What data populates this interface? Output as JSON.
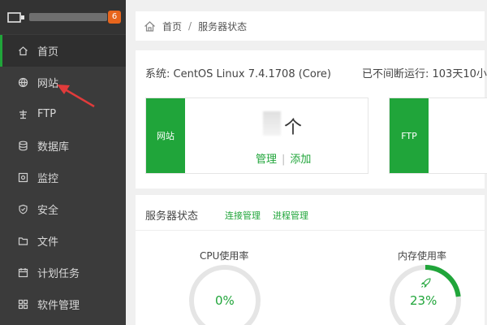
{
  "sidebar": {
    "badge": "6",
    "items": [
      {
        "label": "首页",
        "icon": "home-icon"
      },
      {
        "label": "网站",
        "icon": "globe-icon"
      },
      {
        "label": "FTP",
        "icon": "ftp-icon"
      },
      {
        "label": "数据库",
        "icon": "database-icon"
      },
      {
        "label": "监控",
        "icon": "monitor-icon"
      },
      {
        "label": "安全",
        "icon": "shield-icon"
      },
      {
        "label": "文件",
        "icon": "folder-icon"
      },
      {
        "label": "计划任务",
        "icon": "calendar-icon"
      },
      {
        "label": "软件管理",
        "icon": "apps-icon"
      }
    ]
  },
  "breadcrumb": {
    "home": "首页",
    "separator": "/",
    "current": "服务器状态"
  },
  "system": {
    "os": "系统: CentOS Linux 7.4.1708 (Core)",
    "uptime": "已不间断运行: 103天10小"
  },
  "cards": {
    "site": {
      "tag": "网站",
      "unit": "个",
      "manage": "管理",
      "divider": "|",
      "add": "添加"
    },
    "ftp": {
      "tag": "FTP"
    }
  },
  "status": {
    "title": "服务器状态",
    "link_connections": "连接管理",
    "link_processes": "进程管理",
    "cpu_label": "CPU使用率",
    "cpu_value": "0%",
    "cpu_fraction": 0,
    "mem_label": "内存使用率",
    "mem_value": "23%",
    "mem_fraction": 0.23
  },
  "colors": {
    "accent": "#20a53a",
    "sidebar": "#3b3b3b",
    "badge": "#e8651c",
    "annotation_arrow": "#e03b3b"
  }
}
